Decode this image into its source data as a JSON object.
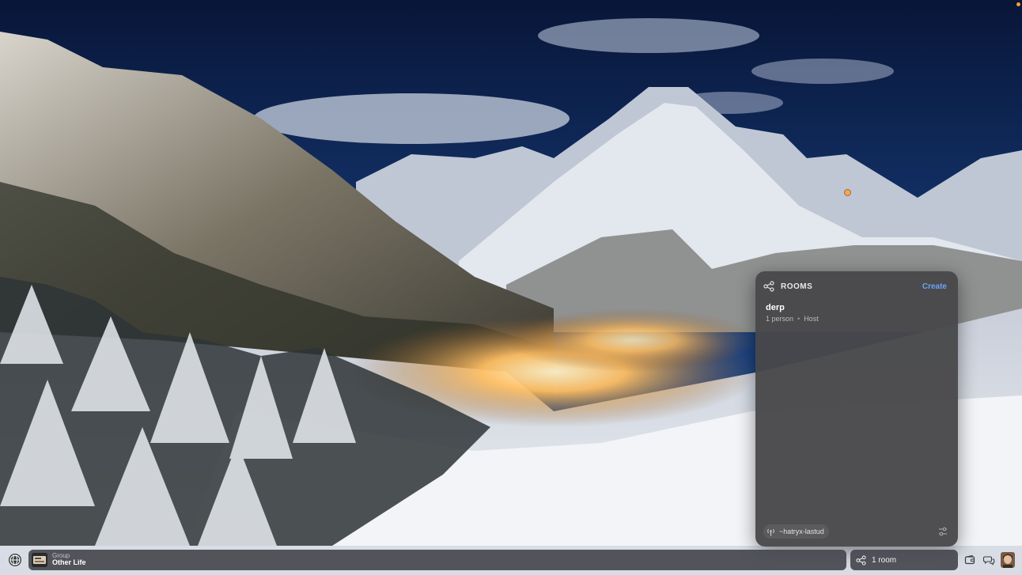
{
  "wallpaper": {
    "colors": {
      "sky_top": "#0a1a44",
      "sky_mid": "#1f4a8f",
      "snow": "#dfe4ec",
      "village_glow": "#ffb25a"
    }
  },
  "rooms_panel": {
    "title": "ROOMS",
    "create_label": "Create",
    "icon": "share-nodes-icon",
    "rooms": [
      {
        "name": "derp",
        "members": "1 person",
        "separator": "•",
        "role": "Host"
      }
    ],
    "footer": {
      "ship": "~hatryx-lastud",
      "ship_icon": "antenna-icon",
      "filter_icon": "sliders-icon"
    },
    "colors": {
      "background": "#48484a",
      "accent": "#6ea0f3"
    }
  },
  "taskbar": {
    "home_icon": "globe-icon",
    "group": {
      "kind": "Group",
      "name": "Other Life"
    },
    "rooms_chip": {
      "label": "1 room",
      "icon": "share-nodes-icon"
    },
    "tray": [
      {
        "name": "wallet-icon"
      },
      {
        "name": "chat-bubbles-icon"
      }
    ],
    "avatar": "user-avatar"
  }
}
